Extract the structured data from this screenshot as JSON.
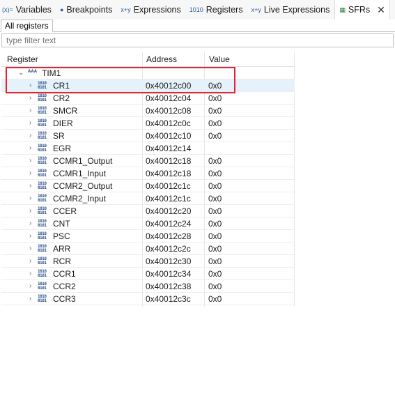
{
  "tabs": [
    {
      "label": "Variables",
      "icon": "(x)="
    },
    {
      "label": "Breakpoints",
      "icon": "●"
    },
    {
      "label": "Expressions",
      "icon": "x+y"
    },
    {
      "label": "Registers",
      "icon": "1010"
    },
    {
      "label": "Live Expressions",
      "icon": "x+y"
    },
    {
      "label": "SFRs",
      "icon": "▦",
      "active": true
    }
  ],
  "subtab": "All registers",
  "filter": {
    "placeholder": "type filter text"
  },
  "columns": {
    "register": "Register",
    "address": "Address",
    "value": "Value"
  },
  "peripheral": {
    "name": "TIM1"
  },
  "registers": [
    {
      "name": "CR1",
      "address": "0x40012c00",
      "value": "0x0"
    },
    {
      "name": "CR2",
      "address": "0x40012c04",
      "value": "0x0"
    },
    {
      "name": "SMCR",
      "address": "0x40012c08",
      "value": "0x0"
    },
    {
      "name": "DIER",
      "address": "0x40012c0c",
      "value": "0x0"
    },
    {
      "name": "SR",
      "address": "0x40012c10",
      "value": "0x0"
    },
    {
      "name": "EGR",
      "address": "0x40012c14",
      "value": ""
    },
    {
      "name": "CCMR1_Output",
      "address": "0x40012c18",
      "value": "0x0"
    },
    {
      "name": "CCMR1_Input",
      "address": "0x40012c18",
      "value": "0x0"
    },
    {
      "name": "CCMR2_Output",
      "address": "0x40012c1c",
      "value": "0x0"
    },
    {
      "name": "CCMR2_Input",
      "address": "0x40012c1c",
      "value": "0x0"
    },
    {
      "name": "CCER",
      "address": "0x40012c20",
      "value": "0x0"
    },
    {
      "name": "CNT",
      "address": "0x40012c24",
      "value": "0x0"
    },
    {
      "name": "PSC",
      "address": "0x40012c28",
      "value": "0x0"
    },
    {
      "name": "ARR",
      "address": "0x40012c2c",
      "value": "0x0"
    },
    {
      "name": "RCR",
      "address": "0x40012c30",
      "value": "0x0"
    },
    {
      "name": "CCR1",
      "address": "0x40012c34",
      "value": "0x0"
    },
    {
      "name": "CCR2",
      "address": "0x40012c38",
      "value": "0x0"
    },
    {
      "name": "CCR3",
      "address": "0x40012c3c",
      "value": "0x0"
    }
  ],
  "colors": {
    "highlight": "#e02432",
    "selected_row": "#e6f2fb"
  }
}
